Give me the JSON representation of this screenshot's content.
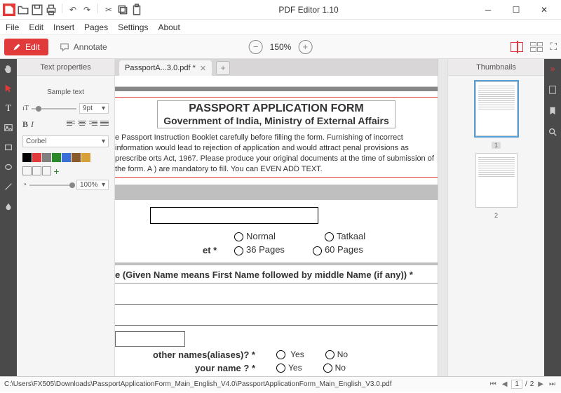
{
  "app": {
    "title": "PDF Editor 1.10"
  },
  "menu": {
    "file": "File",
    "edit": "Edit",
    "insert": "Insert",
    "pages": "Pages",
    "settings": "Settings",
    "about": "About"
  },
  "toolbar": {
    "edit": "Edit",
    "annotate": "Annotate",
    "zoom": "150%"
  },
  "panels": {
    "text_props": "Text properties",
    "thumbnails": "Thumbnails"
  },
  "text_props": {
    "sample": "Sample text",
    "font_size": "9pt",
    "font_family": "Corbel",
    "opacity": "100%",
    "colors": [
      "#000000",
      "#e03a3a",
      "#808080",
      "#2a8a2a",
      "#3a6fd6",
      "#8a5a2a",
      "#d6a03a"
    ]
  },
  "tab": {
    "name": "PassportA...3.0.pdf *"
  },
  "document": {
    "title1": "PASSPORT APPLICATION FORM",
    "title2": "Government of India, Ministry of External Affairs",
    "para": "e Passport Instruction Booklet carefully before filling the form. Furnishing of incorrect information would lead to rejection of application and would attract penal provisions as prescribe orts Act, 1967. Please produce your original documents at the time of submission of the form. A ) are mandatory to fill.  You can EVEN ADD TEXT.",
    "opt_normal": "Normal",
    "opt_tatkaal": "Tatkaal",
    "opt_36": "36 Pages",
    "opt_60": "60 Pages",
    "frag_et": "et *",
    "given_name": "e (Given Name means First Name followed by middle Name (if any)) *",
    "aliases": "other names(aliases)? *",
    "changed": "your name ? *",
    "yes": "Yes",
    "no": "No"
  },
  "thumbs": {
    "p1": "1",
    "p2": "2"
  },
  "status": {
    "path": "C:\\Users\\FX505\\Downloads\\PassportApplicationForm_Main_English_V4.0\\PassportApplicationForm_Main_English_V3.0.pdf",
    "page_cur": "1",
    "page_sep": "/",
    "page_total": "2"
  }
}
